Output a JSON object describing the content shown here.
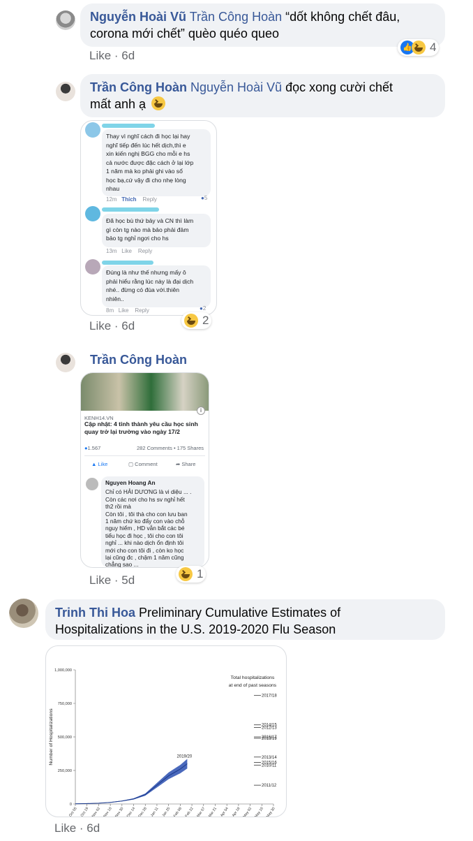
{
  "comments": [
    {
      "author": "Nguyễn Hoài Vũ",
      "mention": "Trần Công Hoàn",
      "text_line1": " “dốt không chết đâu,",
      "text_line2": "corona mới chết” quèo quéo queo",
      "like": "Like",
      "dot": " · ",
      "time": "6d",
      "reaction_count": "4"
    },
    {
      "author": "Trần Công Hoàn",
      "mention": "Nguyễn Hoài Vũ",
      "text_line1": " đọc xong cười chết",
      "text_line2": "mất anh ạ",
      "like": "Like",
      "dot": " · ",
      "time": "6d",
      "reaction_count": "2",
      "screenshot": {
        "c1_lines": [
          "Thay vì nghĩ cách đi học lại hay",
          "nghĩ tiếp đến lúc hết dịch,thì e",
          "xin kiến nghị BGG cho mỗi e hs",
          "cả nước được đặc cách ở lại lớp",
          "1 năm mà ko phải ghi vào sổ",
          "học bạ,cứ vậy đi cho nhẹ lòng",
          "nhau"
        ],
        "c1_time": "12m",
        "c1_like": "Thích",
        "c1_reply": "Reply",
        "c1_count": "5",
        "c2_lines": [
          "Đã học bù thứ bảy và CN thì làm",
          "gì còn tg nào mà bảo phải đảm",
          "bảo tg nghỉ ngơi cho hs"
        ],
        "c2_time": "13m",
        "c2_like": "Like",
        "c2_reply": "Reply",
        "c3_lines": [
          "Đúng là như thế  nhưng mấy ô",
          "phải hiểu rằng lúc này là đại dịch",
          "nhé.. đừng có đùa với.thiên",
          "nhiên.."
        ],
        "c3_time": "8m",
        "c3_like": "Like",
        "c3_reply": "Reply",
        "c3_count": "2"
      }
    },
    {
      "author": "Trần Công Hoàn",
      "like": "Like",
      "dot": " · ",
      "time": "5d",
      "reaction_count": "1",
      "post": {
        "source": "KENH14.VN",
        "headline_line1": "Cập nhật: 4 tỉnh thành yêu cầu học sinh",
        "headline_line2": "quay trở lại trường vào ngày 17/2",
        "reactions": "1.567",
        "comments": "282 Comments • 175 Shares",
        "like": "Like",
        "comment": "Comment",
        "share": "Share",
        "commenter": "Nguyen Hoang An",
        "comment_lines": [
          "Chỉ có HẢI DƯƠNG là vi diệu ... .",
          "Còn các nơi cho hs sv nghỉ hết",
          "th2  rồi mà",
          "Còn tôi , tôi thà cho con lưu ban",
          "1 năm chứ ko đẩy con vào chỗ",
          "nguy hiểm , HD vẫn bắt các bé",
          "tiểu học đi học , tôi cho con tôi",
          "nghỉ ... khi nào dịch ổn định tôi",
          "mới cho con tôi đi , còn ko học",
          "lại cũng đc , chậm 1 năm cũng",
          "chẳng sao ..."
        ]
      }
    },
    {
      "author": "Trinh Thi Hoa",
      "text_line1": " Preliminary Cumulative Estimates of",
      "text_line2": "Hospitalizations in the U.S. 2019-2020 Flu Season",
      "like": "Like",
      "dot": " · ",
      "time": "6d"
    }
  ],
  "chart_data": {
    "type": "line",
    "title": "",
    "ylabel": "Number of Hospitalizations",
    "xlabel": "",
    "ylim": [
      0,
      1000000
    ],
    "yticks": [
      "0",
      "250,000",
      "500,000",
      "750,000",
      "1,000,000"
    ],
    "yticks_values": [
      0,
      250000,
      500000,
      750000,
      1000000
    ],
    "xticks": [
      "Oct 05",
      "Oct 19",
      "Nov 02",
      "Nov 16",
      "Nov 30",
      "Dec 14",
      "Dec 28",
      "Jan 11",
      "Jan 25",
      "Feb 08",
      "Feb 22",
      "Mar 07",
      "Mar 21",
      "Apr 04",
      "Apr 18",
      "May 02",
      "May 16",
      "May 30"
    ],
    "legend_title_line1": "Total hospitalizations",
    "legend_title_line2": "at end of past seasons",
    "season_label": "2019/20",
    "series": [
      {
        "name": "2019/20",
        "x_index": [
          0,
          1,
          2,
          3,
          4,
          5,
          6,
          7,
          8,
          9,
          9.6
        ],
        "values": [
          1000,
          3000,
          6000,
          12000,
          22000,
          38000,
          70000,
          140000,
          210000,
          260000,
          300000
        ]
      }
    ],
    "past_seasons": [
      {
        "name": "2017/18",
        "value": 810000
      },
      {
        "name": "2014/15",
        "value": 590000
      },
      {
        "name": "2012/13",
        "value": 570000
      },
      {
        "name": "2016/17",
        "value": 500000
      },
      {
        "name": "2018/19",
        "value": 490000
      },
      {
        "name": "2013/14",
        "value": 350000
      },
      {
        "name": "2015/16",
        "value": 310000
      },
      {
        "name": "2010/11",
        "value": 290000
      },
      {
        "name": "2011/12",
        "value": 140000
      }
    ]
  }
}
